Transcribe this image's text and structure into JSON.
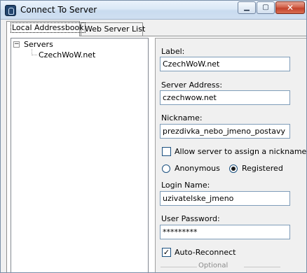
{
  "window": {
    "title": "Connect To Server",
    "minimize_glyph": "▁",
    "maximize_glyph": "▢",
    "close_glyph": "✕"
  },
  "tabs": [
    {
      "label": "Local Addressbook",
      "active": true
    },
    {
      "label": "Web Server List",
      "active": false
    }
  ],
  "tree": {
    "root_label": "Servers",
    "expander_glyph": "−",
    "children": [
      "CzechWoW.net"
    ]
  },
  "form": {
    "label": {
      "caption": "Label:",
      "value": "CzechWoW.net"
    },
    "server_address": {
      "caption": "Server Address:",
      "value": "czechwow.net"
    },
    "nickname": {
      "caption": "Nickname:",
      "value": "prezdivka_nebo_jmeno_postavy"
    },
    "assign_nickname": {
      "caption": "Allow server to assign a nickname",
      "checked": false
    },
    "auth_mode": {
      "options": [
        {
          "label": "Anonymous",
          "selected": false
        },
        {
          "label": "Registered",
          "selected": true
        }
      ]
    },
    "login_name": {
      "caption": "Login Name:",
      "value": "uzivatelske_jmeno"
    },
    "user_password": {
      "caption": "User Password:",
      "value": "*********"
    },
    "auto_reconnect": {
      "caption": "Auto-Reconnect",
      "checked": true,
      "check_glyph": "✓"
    },
    "optional_section": "Optional"
  }
}
